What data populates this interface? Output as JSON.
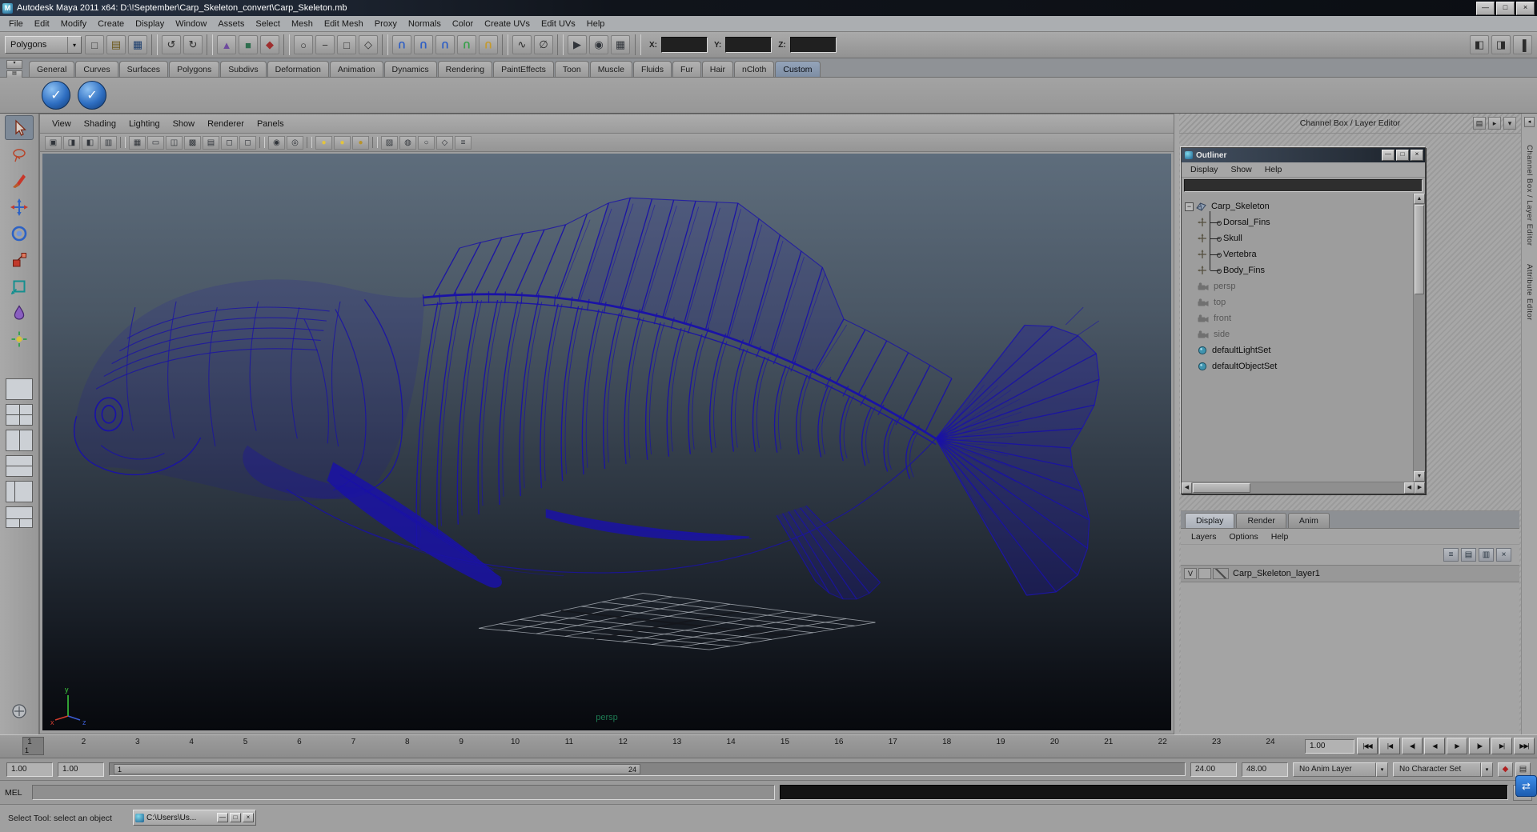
{
  "window": {
    "title": "Autodesk Maya 2011 x64: D:\\!September\\Carp_Skeleton_convert\\Carp_Skeleton.mb",
    "buttons": [
      {
        "name": "minimize-button",
        "glyph": "—"
      },
      {
        "name": "maximize-button",
        "glyph": "□"
      },
      {
        "name": "close-button",
        "glyph": "×"
      }
    ]
  },
  "menubar": {
    "items": [
      "File",
      "Edit",
      "Modify",
      "Create",
      "Display",
      "Window",
      "Assets",
      "Select",
      "Mesh",
      "Edit Mesh",
      "Proxy",
      "Normals",
      "Color",
      "Create UVs",
      "Edit UVs",
      "Help"
    ]
  },
  "statusline": {
    "mode": "Polygons",
    "x_label": "X:",
    "y_label": "Y:",
    "z_label": "Z:",
    "groups": [
      {
        "icons": [
          {
            "name": "new-scene-icon",
            "glyph": "□",
            "color": "#3a3a3a"
          },
          {
            "name": "open-scene-icon",
            "glyph": "▤",
            "color": "#6b5718"
          },
          {
            "name": "save-scene-icon",
            "glyph": "▦",
            "color": "#1c3e6e"
          }
        ]
      },
      {
        "icons": [
          {
            "name": "undo-icon",
            "glyph": "↺",
            "color": "#2c2c2c"
          },
          {
            "name": "redo-icon",
            "glyph": "↻",
            "color": "#2c2c2c"
          }
        ]
      },
      {
        "icons": [
          {
            "name": "select-hierarchy-icon",
            "glyph": "▲",
            "color": "#6e4b9e"
          },
          {
            "name": "select-object-icon",
            "glyph": "■",
            "color": "#2e6e4e"
          },
          {
            "name": "select-component-icon",
            "glyph": "◆",
            "color": "#9e2e2e"
          }
        ]
      },
      {
        "icons": [
          {
            "name": "mask-points-icon",
            "glyph": "○",
            "color": "#333"
          },
          {
            "name": "mask-lines-icon",
            "glyph": "−",
            "color": "#333"
          },
          {
            "name": "mask-faces-icon",
            "glyph": "□",
            "color": "#333"
          },
          {
            "name": "mask-handles-icon",
            "glyph": "◇",
            "color": "#333"
          }
        ]
      },
      {
        "icons": [
          {
            "name": "snap-to-grid-icon",
            "glyph": "U",
            "color": "#2e5ec4",
            "magnet": true
          },
          {
            "name": "snap-to-curve-icon",
            "glyph": "U",
            "color": "#2e5ec4",
            "magnet": true
          },
          {
            "name": "snap-to-point-icon",
            "glyph": "U",
            "color": "#2e5ec4",
            "magnet": true
          },
          {
            "name": "snap-to-plane-icon",
            "glyph": "U",
            "color": "#38a04a",
            "magnet": true
          },
          {
            "name": "make-live-icon",
            "glyph": "U",
            "color": "#c49a2e",
            "magnet": true
          }
        ]
      },
      {
        "icons": [
          {
            "name": "construction-history-icon",
            "glyph": "∿",
            "color": "#2c2c2c"
          },
          {
            "name": "no-construction-history-icon",
            "glyph": "∅",
            "color": "#2c2c2c"
          }
        ]
      },
      {
        "icons": [
          {
            "name": "render-current-frame-icon",
            "glyph": "▶",
            "color": "#30343a"
          },
          {
            "name": "ipr-render-icon",
            "glyph": "◉",
            "color": "#30343a"
          },
          {
            "name": "render-settings-icon",
            "glyph": "▦",
            "color": "#30343a"
          }
        ]
      }
    ],
    "right_icons": [
      {
        "name": "open-tool-settings-icon",
        "glyph": "◧"
      },
      {
        "name": "open-attribute-editor-icon",
        "glyph": "◨"
      },
      {
        "name": "open-channel-box-icon",
        "glyph": "▐"
      }
    ]
  },
  "shelf": {
    "tabs": [
      "General",
      "Curves",
      "Surfaces",
      "Polygons",
      "Subdivs",
      "Deformation",
      "Animation",
      "Dynamics",
      "Rendering",
      "PaintEffects",
      "Toon",
      "Muscle",
      "Fluids",
      "Fur",
      "Hair",
      "nCloth",
      "Custom"
    ],
    "active_tab": "Custom",
    "nav": [
      {
        "name": "shelf-tab-switcher-button",
        "glyph": "▾"
      },
      {
        "name": "shelf-menu-button",
        "glyph": "▤"
      }
    ],
    "items": [
      {
        "name": "custom-shelf-button-1",
        "glyph": "✓"
      },
      {
        "name": "custom-shelf-button-2",
        "glyph": "✓"
      }
    ]
  },
  "toolbox": {
    "tools": [
      {
        "name": "select-tool",
        "active": true
      },
      {
        "name": "lasso-tool"
      },
      {
        "name": "paint-select-tool"
      },
      {
        "name": "move-tool"
      },
      {
        "name": "rotate-tool"
      },
      {
        "name": "scale-tool"
      },
      {
        "name": "universal-manipulator-tool"
      },
      {
        "name": "soft-mod-tool"
      },
      {
        "name": "show-manipulator-tool"
      }
    ],
    "layouts": [
      {
        "name": "single-pane-layout"
      },
      {
        "name": "four-pane-layout"
      },
      {
        "name": "two-pane-side-layout"
      },
      {
        "name": "two-pane-stacked-layout"
      },
      {
        "name": "persp-outliner-layout"
      },
      {
        "name": "hypergraph-persp-layout"
      }
    ]
  },
  "viewport": {
    "menus": [
      "View",
      "Shading",
      "Lighting",
      "Show",
      "Renderer",
      "Panels"
    ],
    "icons": [
      {
        "name": "select-camera-icon",
        "glyph": "▣"
      },
      {
        "name": "camera-attributes-icon",
        "glyph": "◨"
      },
      {
        "name": "bookmark-icon",
        "glyph": "◧"
      },
      {
        "name": "image-plane-icon",
        "glyph": "▥"
      },
      {
        "sep": true
      },
      {
        "name": "grid-icon",
        "glyph": "▦"
      },
      {
        "name": "film-gate-icon",
        "glyph": "▭"
      },
      {
        "name": "resolution-gate-icon",
        "glyph": "◫"
      },
      {
        "name": "gate-mask-icon",
        "glyph": "▩"
      },
      {
        "name": "field-chart-icon",
        "glyph": "▤"
      },
      {
        "name": "safe-action-icon",
        "glyph": "◻"
      },
      {
        "name": "safe-title-icon",
        "glyph": "◻"
      },
      {
        "sep": true
      },
      {
        "name": "frame-all-icon",
        "glyph": "◉"
      },
      {
        "name": "frame-selection-icon",
        "glyph": "◎"
      },
      {
        "sep": true
      },
      {
        "name": "default-lighting-icon",
        "glyph": "●",
        "color": "#e3c43c"
      },
      {
        "name": "all-lights-icon",
        "glyph": "●",
        "color": "#e3c43c"
      },
      {
        "name": "shadows-icon",
        "glyph": "●",
        "color": "#b8932a"
      },
      {
        "sep": true
      },
      {
        "name": "textured-display-icon",
        "glyph": "▨"
      },
      {
        "name": "wireframe-on-shaded-icon",
        "glyph": "◍"
      },
      {
        "name": "xray-display-icon",
        "glyph": "○"
      },
      {
        "name": "isolate-select-icon",
        "glyph": "◇"
      },
      {
        "name": "multi-lister-icon",
        "glyph": "≡"
      }
    ],
    "camera_label": "persp",
    "axis": {
      "x": "x",
      "y": "y",
      "z": "z"
    }
  },
  "right_header": {
    "title": "Channel Box / Layer Editor",
    "icons": [
      {
        "name": "channel-slider-icon",
        "glyph": "▤"
      },
      {
        "name": "channel-speed-icon",
        "glyph": "▸"
      },
      {
        "name": "channel-options-icon",
        "glyph": "▾"
      }
    ]
  },
  "side_tabs": [
    "Channel Box / Layer Editor",
    "Attribute Editor"
  ],
  "outliner": {
    "title": "Outliner",
    "menus": [
      "Display",
      "Show",
      "Help"
    ],
    "buttons": [
      {
        "name": "outliner-minimize-button",
        "glyph": "—"
      },
      {
        "name": "outliner-maximize-button",
        "glyph": "□"
      },
      {
        "name": "outliner-close-button",
        "glyph": "×"
      }
    ],
    "nodes": [
      {
        "label": "Carp_Skeleton",
        "type": "root"
      },
      {
        "label": "Dorsal_Fins",
        "type": "child"
      },
      {
        "label": "Skull",
        "type": "child"
      },
      {
        "label": "Vertebra",
        "type": "child"
      },
      {
        "label": "Body_Fins",
        "type": "child"
      },
      {
        "label": "persp",
        "type": "camera",
        "muted": true
      },
      {
        "label": "top",
        "type": "camera",
        "muted": true
      },
      {
        "label": "front",
        "type": "camera",
        "muted": true
      },
      {
        "label": "side",
        "type": "camera",
        "muted": true
      },
      {
        "label": "defaultLightSet",
        "type": "set"
      },
      {
        "label": "defaultObjectSet",
        "type": "set"
      }
    ]
  },
  "layer_editor": {
    "tabs": [
      "Display",
      "Render",
      "Anim"
    ],
    "active_tab": "Display",
    "menus": [
      "Layers",
      "Options",
      "Help"
    ],
    "icons": [
      {
        "name": "sort-layers-icon",
        "glyph": "≡"
      },
      {
        "name": "new-empty-layer-icon",
        "glyph": "▤"
      },
      {
        "name": "new-layer-from-selected-icon",
        "glyph": "▥"
      },
      {
        "name": "delete-layer-icon",
        "glyph": "×"
      }
    ],
    "layers": [
      {
        "visible": "V",
        "name": "Carp_Skeleton_layer1"
      }
    ]
  },
  "timeline": {
    "frames": [
      "1",
      "2",
      "3",
      "4",
      "5",
      "6",
      "7",
      "8",
      "9",
      "10",
      "11",
      "12",
      "13",
      "14",
      "15",
      "16",
      "17",
      "18",
      "19",
      "20",
      "21",
      "22",
      "23",
      "24"
    ],
    "current": "1"
  },
  "playback": {
    "speed": "1.00",
    "buttons": [
      {
        "name": "go-to-start-button",
        "glyph": "|◀◀"
      },
      {
        "name": "step-back-key-button",
        "glyph": "|◀"
      },
      {
        "name": "step-back-frame-button",
        "glyph": "◀|"
      },
      {
        "name": "play-backwards-button",
        "glyph": "◀"
      },
      {
        "name": "play-forwards-button",
        "glyph": "▶"
      },
      {
        "name": "step-forward-frame-button",
        "glyph": "|▶"
      },
      {
        "name": "step-forward-key-button",
        "glyph": "▶|"
      },
      {
        "name": "go-to-end-button",
        "glyph": "▶▶|"
      }
    ]
  },
  "range": {
    "anim_start": "1.00",
    "play_start": "1.00",
    "bar_start": "1",
    "bar_end": "24",
    "play_end": "24.00",
    "anim_end": "48.00",
    "anim_layer": "No Anim Layer",
    "character_set": "No Character Set",
    "icons": [
      {
        "name": "auto-keyframe-button",
        "glyph": "◆",
        "color": "#b02020"
      },
      {
        "name": "animation-preferences-button",
        "glyph": "▤",
        "color": "#2c2c2c"
      }
    ]
  },
  "mel": {
    "label": "MEL"
  },
  "helpline": {
    "text": "Select Tool: select an object"
  },
  "minimized": {
    "title": "C:\\Users\\Us...",
    "buttons": [
      {
        "name": "mini-minimize-button",
        "glyph": "—"
      },
      {
        "name": "mini-maximize-button",
        "glyph": "□"
      },
      {
        "name": "mini-close-button",
        "glyph": "×"
      }
    ]
  }
}
